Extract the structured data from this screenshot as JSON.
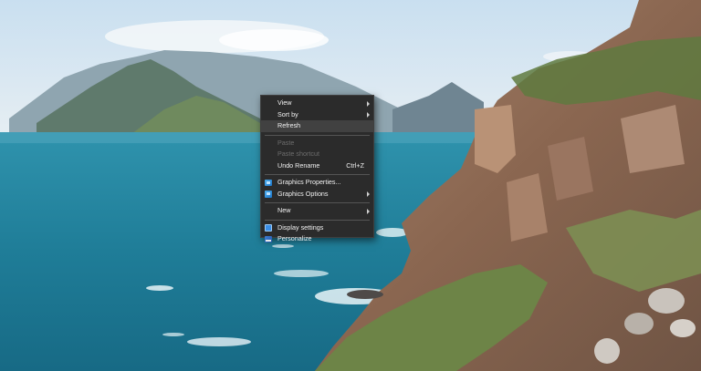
{
  "desktop": {
    "wallpaper": "coastal-cliffs-ocean-landscape"
  },
  "context_menu": {
    "groups": [
      [
        {
          "label": "View",
          "submenu": true
        },
        {
          "label": "Sort by",
          "submenu": true
        },
        {
          "label": "Refresh",
          "highlighted": true
        }
      ],
      [
        {
          "label": "Paste",
          "disabled": true
        },
        {
          "label": "Paste shortcut",
          "disabled": true
        },
        {
          "label": "Undo Rename",
          "shortcut": "Ctrl+Z"
        }
      ],
      [
        {
          "label": "Graphics Properties...",
          "icon": "graphics-icon"
        },
        {
          "label": "Graphics Options",
          "icon": "graphics-icon",
          "submenu": true
        }
      ],
      [
        {
          "label": "New",
          "submenu": true
        }
      ],
      [
        {
          "label": "Display settings",
          "icon": "display-icon"
        },
        {
          "label": "Personalize",
          "icon": "personalize-icon"
        }
      ]
    ]
  },
  "colors": {
    "menu_background": "#2b2b2b",
    "menu_highlight": "#414141",
    "menu_text": "#f2f2f2",
    "menu_disabled_text": "#6d6d6d"
  }
}
